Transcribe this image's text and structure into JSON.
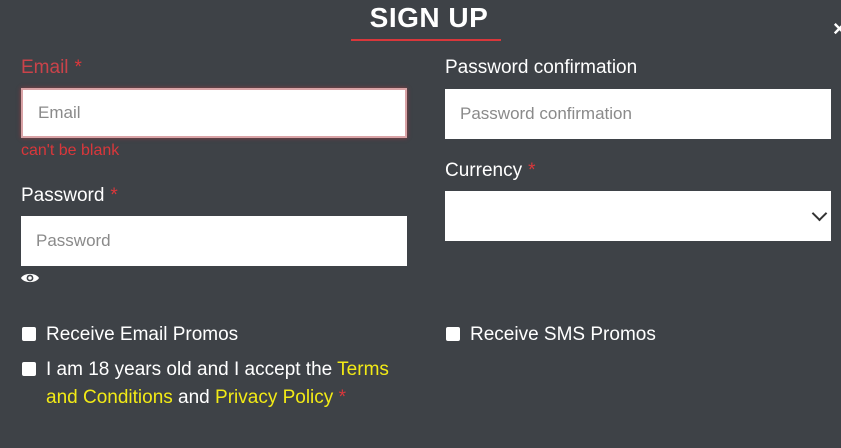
{
  "header": {
    "title": "SIGN UP",
    "close_icon": "×"
  },
  "email": {
    "label": "Email",
    "required_mark": "*",
    "placeholder": "Email",
    "value": "",
    "error": "can't be blank"
  },
  "password": {
    "label": "Password",
    "required_mark": "*",
    "placeholder": "Password",
    "value": ""
  },
  "password_confirmation": {
    "label": "Password confirmation",
    "placeholder": "Password confirmation",
    "value": ""
  },
  "currency": {
    "label": "Currency",
    "required_mark": "*",
    "selected": ""
  },
  "options": {
    "email_promos": "Receive Email Promos",
    "sms_promos": "Receive SMS Promos",
    "terms_prefix": "I am 18 years old and I accept the",
    "terms_link": "Terms and Conditions",
    "terms_and": "and",
    "privacy_link": "Privacy Policy",
    "required_mark": "*"
  },
  "colors": {
    "background": "#3e4247",
    "accent": "#d9373b",
    "link": "#f2ea16"
  }
}
